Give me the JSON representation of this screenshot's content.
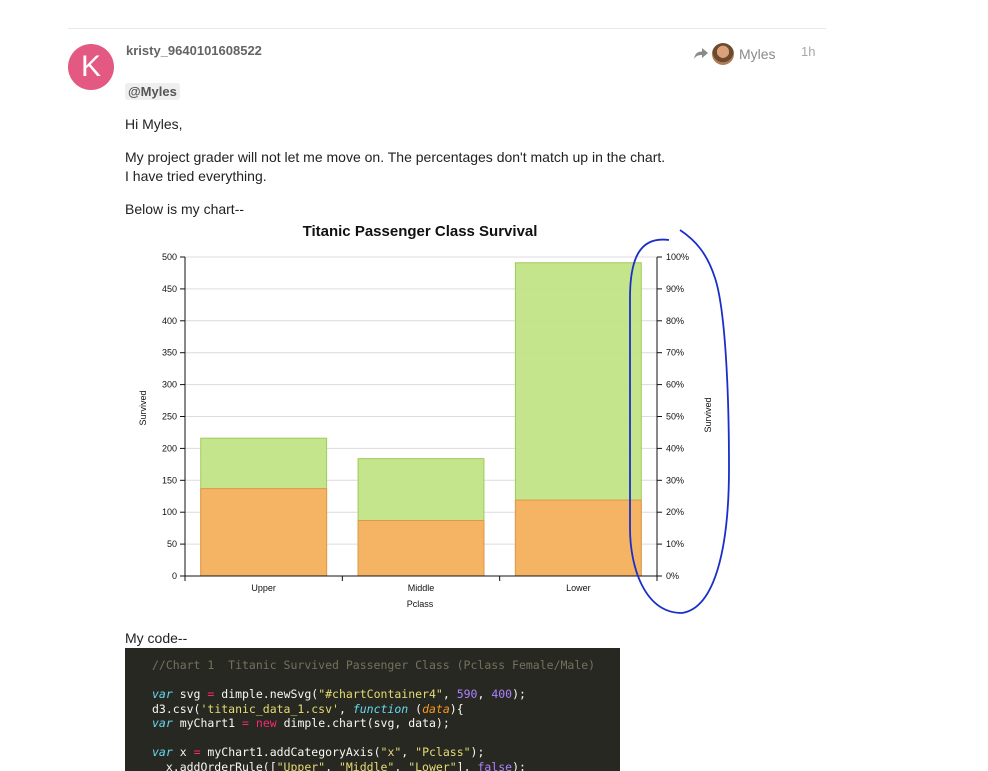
{
  "post": {
    "avatar_letter": "K",
    "username": "kristy_9640101608522",
    "reply_to": "Myles",
    "age": "1h",
    "mention": "@Myles",
    "greeting": "Hi Myles,",
    "line1": "My project grader will not let me move on. The percentages don't match up in the chart.",
    "line2": "I have tried everything.",
    "chart_intro": "Below is my chart--",
    "code_intro": "My code--",
    "colors": {
      "avatar": "#e45982",
      "green": "#c2e487",
      "orange": "#f7b162",
      "annotation": "#1a2fc9"
    }
  },
  "chart_data": {
    "type": "bar",
    "title": "Titanic Passenger Class Survival",
    "xlabel": "Pclass",
    "ylabel": "Survived",
    "y2label": "Survived",
    "categories": [
      "Upper",
      "Middle",
      "Lower"
    ],
    "series": [
      {
        "values": [
          137,
          87,
          119
        ],
        "color": "#f7b162"
      },
      {
        "values": [
          216,
          184,
          491
        ],
        "color": "#c2e487"
      }
    ],
    "ylim": [
      0,
      500
    ],
    "yticks": [
      "0",
      "50",
      "100",
      "150",
      "200",
      "250",
      "300",
      "350",
      "400",
      "450",
      "500"
    ],
    "y2ticks": [
      "0%",
      "10%",
      "20%",
      "30%",
      "40%",
      "50%",
      "60%",
      "70%",
      "80%",
      "90%",
      "100%"
    ],
    "grid": true
  },
  "code": {
    "lines": [
      [
        {
          "t": "//Chart 1  Titanic Survived Passenger Class (Pclass Female/Male)",
          "c": "c-cm"
        }
      ],
      [],
      [
        {
          "t": "var",
          "c": "c-kw"
        },
        {
          "t": " svg "
        },
        {
          "t": "=",
          "c": "c-op"
        },
        {
          "t": " dimple.newSvg("
        },
        {
          "t": "\"#chartContainer4\"",
          "c": "c-st"
        },
        {
          "t": ", "
        },
        {
          "t": "590",
          "c": "c-nm"
        },
        {
          "t": ", "
        },
        {
          "t": "400",
          "c": "c-nm"
        },
        {
          "t": ");"
        }
      ],
      [
        {
          "t": "d3.csv("
        },
        {
          "t": "'titanic_data_1.csv'",
          "c": "c-st"
        },
        {
          "t": ", "
        },
        {
          "t": "function",
          "c": "c-fn"
        },
        {
          "t": " ("
        },
        {
          "t": "data",
          "c": "c-pr"
        },
        {
          "t": "){"
        }
      ],
      [
        {
          "t": "var",
          "c": "c-kw"
        },
        {
          "t": " myChart1 "
        },
        {
          "t": "=",
          "c": "c-op"
        },
        {
          "t": " "
        },
        {
          "t": "new",
          "c": "c-op"
        },
        {
          "t": " dimple.chart(svg, data);"
        }
      ],
      [],
      [
        {
          "t": "var",
          "c": "c-kw"
        },
        {
          "t": " x "
        },
        {
          "t": "=",
          "c": "c-op"
        },
        {
          "t": " myChart1.addCategoryAxis("
        },
        {
          "t": "\"x\"",
          "c": "c-st"
        },
        {
          "t": ", "
        },
        {
          "t": "\"Pclass\"",
          "c": "c-st"
        },
        {
          "t": ");"
        }
      ],
      [
        {
          "t": "  x.addOrderRule(["
        },
        {
          "t": "\"Upper\"",
          "c": "c-st"
        },
        {
          "t": ", "
        },
        {
          "t": "\"Middle\"",
          "c": "c-st"
        },
        {
          "t": ", "
        },
        {
          "t": "\"Lower\"",
          "c": "c-st"
        },
        {
          "t": "], "
        },
        {
          "t": "false",
          "c": "c-nm"
        },
        {
          "t": ");"
        }
      ]
    ]
  }
}
